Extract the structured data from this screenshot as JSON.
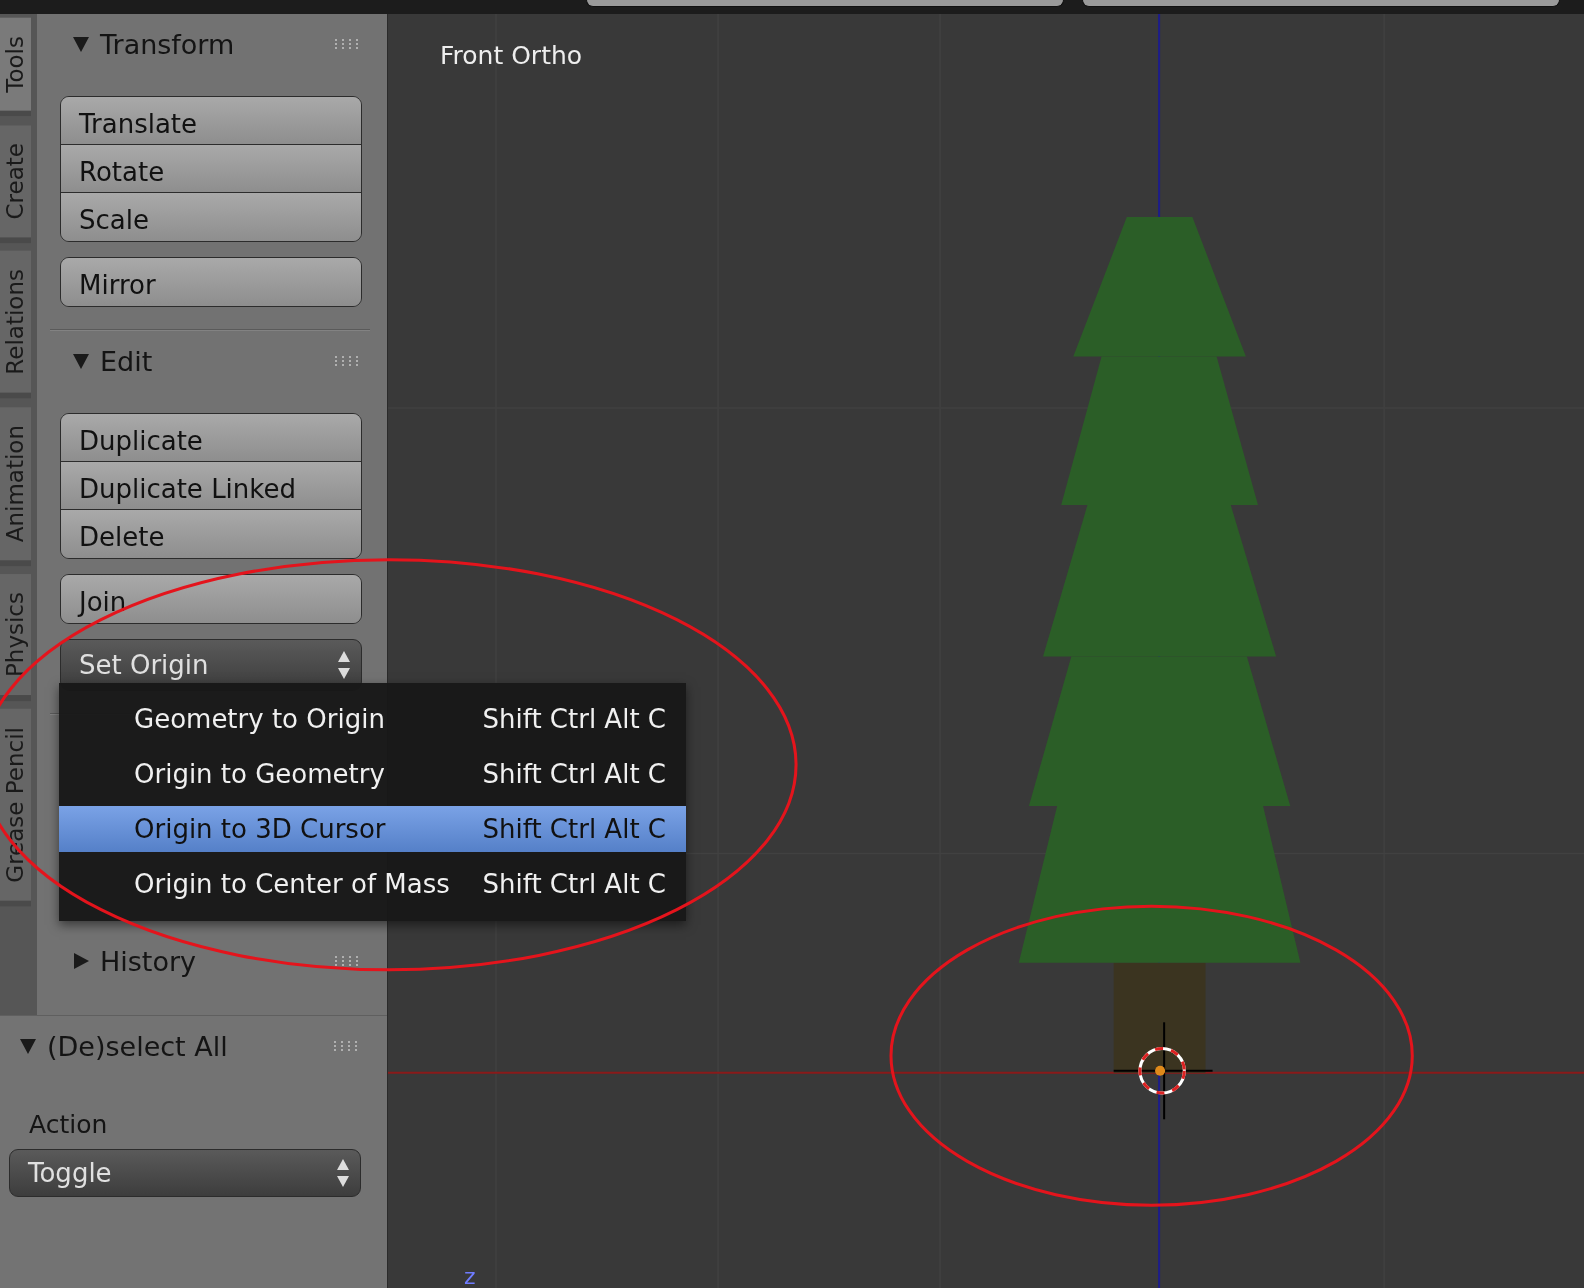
{
  "side_tabs": [
    {
      "label": "Tools",
      "selected": true
    },
    {
      "label": "Create",
      "selected": false
    },
    {
      "label": "Relations",
      "selected": false
    },
    {
      "label": "Animation",
      "selected": false
    },
    {
      "label": "Physics",
      "selected": false
    },
    {
      "label": "Grease Pencil",
      "selected": false
    }
  ],
  "tool_panels": [
    {
      "title": "Transform",
      "expanded": true,
      "groups": [
        [
          "Translate",
          "Rotate",
          "Scale"
        ],
        [
          "Mirror"
        ]
      ]
    },
    {
      "title": "Edit",
      "expanded": true,
      "groups": [
        [
          "Duplicate",
          "Duplicate Linked",
          "Delete"
        ],
        [
          "Join"
        ]
      ],
      "dropdown": "Set Origin"
    },
    {
      "title": "History",
      "expanded": false
    }
  ],
  "origin_menu": {
    "items": [
      {
        "label": "Geometry to Origin",
        "shortcut": "Shift Ctrl Alt C",
        "selected": false
      },
      {
        "label": "Origin to Geometry",
        "shortcut": "Shift Ctrl Alt C",
        "selected": false
      },
      {
        "label": "Origin to 3D Cursor",
        "shortcut": "Shift Ctrl Alt C",
        "selected": true
      },
      {
        "label": "Origin to Center of Mass",
        "shortcut": "Shift Ctrl Alt C",
        "selected": false
      }
    ]
  },
  "operator_panel": {
    "title": "(De)select All",
    "expanded": true,
    "field_label": "Action",
    "field_value": "Toggle"
  },
  "viewport": {
    "view_name": "Front Ortho",
    "axis_label": "z"
  },
  "annotations": [
    {
      "kind": "ellipse"
    },
    {
      "kind": "ellipse"
    }
  ]
}
